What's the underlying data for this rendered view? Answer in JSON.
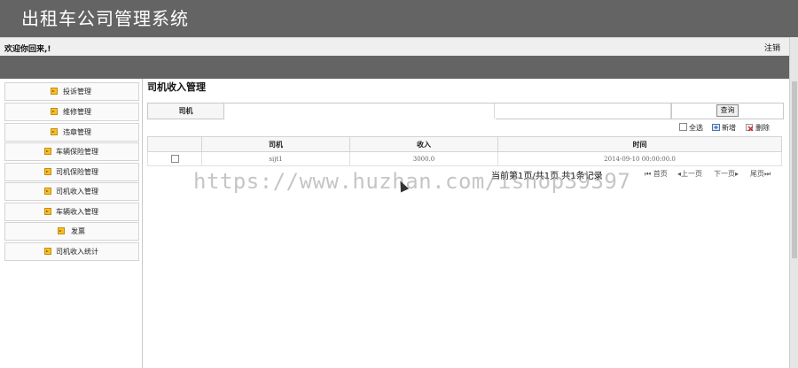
{
  "app": {
    "title": "出租车公司管理系统"
  },
  "header": {
    "welcome": "欢迎你回来,!",
    "logout_label": "注销"
  },
  "sidebar": {
    "items": [
      {
        "label": "投诉管理"
      },
      {
        "label": "维修管理"
      },
      {
        "label": "违章管理"
      },
      {
        "label": "车辆保险管理"
      },
      {
        "label": "司机保险管理"
      },
      {
        "label": "司机收入管理"
      },
      {
        "label": "车辆收入管理"
      },
      {
        "label": "发票"
      },
      {
        "label": "司机收入统计"
      }
    ]
  },
  "main": {
    "title": "司机收入管理",
    "search": {
      "label": "司机",
      "value": "",
      "button_label": "查询"
    },
    "toolbar": {
      "select_all": "全选",
      "add": "新增",
      "delete": "删除"
    },
    "table": {
      "columns": [
        "",
        "司机",
        "收入",
        "时间"
      ],
      "rows": [
        {
          "driver": "sijt1",
          "income": "3000.0",
          "time": "2014-09-10 00:00:00.0"
        }
      ]
    },
    "pager": {
      "info": "当前第1页/共1页  共1条记录",
      "first": "首页",
      "prev": "上一页",
      "next": "下一页",
      "last": "尾页"
    }
  },
  "watermark": "https://www.huzhan.com/ishop39397",
  "colors": {
    "header_bg": "#646464",
    "icon_yellow": "#f3c12a"
  },
  "icons": [
    "arrow-icon",
    "checkbox-icon",
    "add-icon",
    "delete-icon",
    "first-page-icon",
    "prev-page-icon",
    "next-page-icon",
    "last-page-icon"
  ]
}
